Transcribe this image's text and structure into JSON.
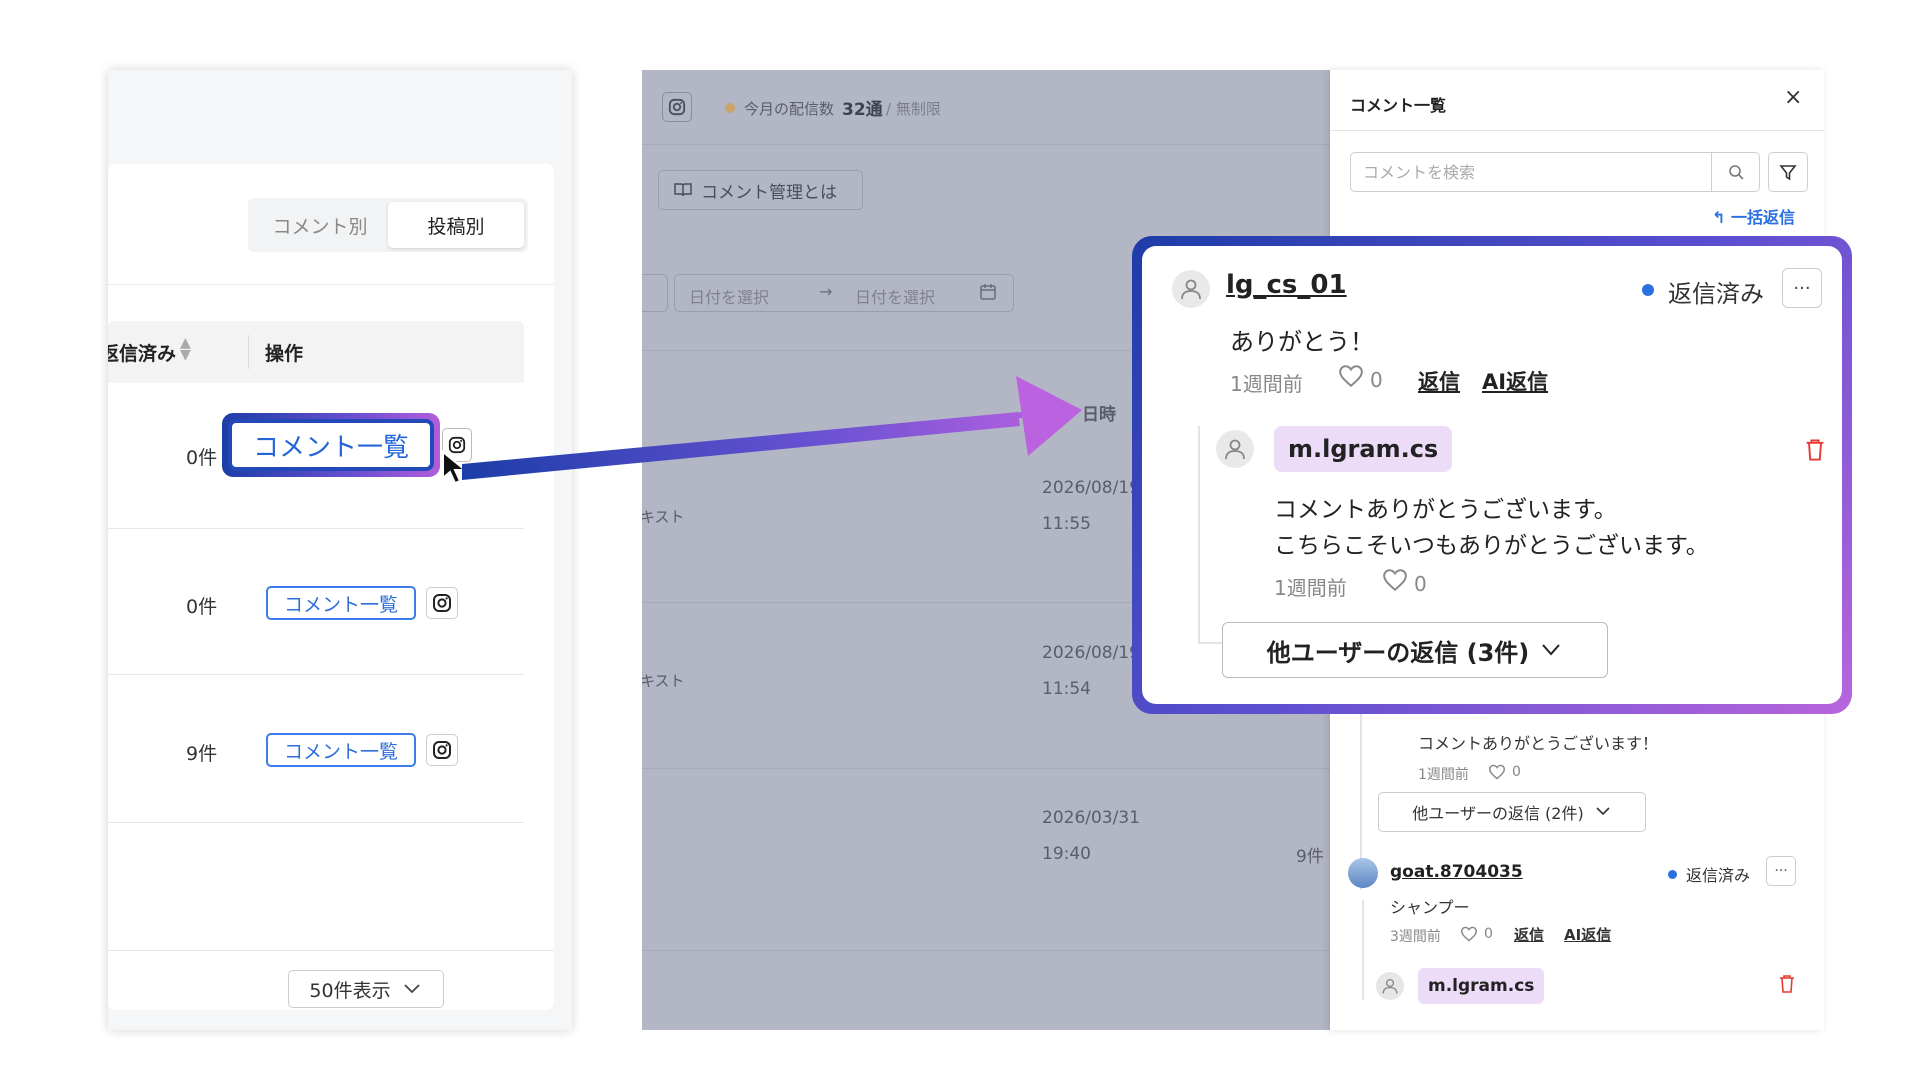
{
  "left": {
    "toggle": {
      "by_comment": "コメント別",
      "by_post": "投稿別"
    },
    "table": {
      "col_replied": "返信済み",
      "col_ops": "操作",
      "rows": [
        {
          "count": "0件",
          "button": "コメント一覧"
        },
        {
          "count": "0件",
          "button": "コメント一覧"
        },
        {
          "count": "9件",
          "button": "コメント一覧"
        }
      ]
    },
    "page_size": "50件表示"
  },
  "center": {
    "delivery_label": "今月の配信数",
    "delivery_count": "32通",
    "delivery_limit": "/ 無制限",
    "help_button": "コメント管理とは",
    "date_from_placeholder": "日付を選択",
    "date_arrow": "→",
    "date_to_placeholder": "日付を選択",
    "col_date": "日時",
    "rows": [
      {
        "text": "キスト",
        "date": "2026/08/19",
        "time": "11:55"
      },
      {
        "text": "キスト",
        "date": "2026/08/19",
        "time": "11:54"
      },
      {
        "text": "",
        "date": "2026/03/31",
        "time": "19:40"
      }
    ],
    "count_9": "9件"
  },
  "drawer": {
    "title": "コメント一覧",
    "close": "×",
    "search_placeholder": "コメントを検索",
    "bulk_reply": "一括返信",
    "partial_reply_text": "コメントありがとうございます！",
    "partial_reply_time": "1週間前",
    "partial_reply_likes": "0",
    "others_2": "他ユーザーの返信 (2件)",
    "goat": {
      "user": "goat.8704035",
      "status": "返信済み",
      "more": "···",
      "text": "シャンプー",
      "time": "3週間前",
      "likes": "0",
      "reply": "返信",
      "ai_reply": "AI返信"
    },
    "reply2_user": "m.lgram.cs"
  },
  "zoom": {
    "user": "lg_cs_01",
    "status": "返信済み",
    "more": "···",
    "text": "ありがとう！",
    "time": "1週間前",
    "likes": "0",
    "reply": "返信",
    "ai_reply": "AI返信",
    "reply_user": "m.lgram.cs",
    "reply_text_1": "コメントありがとうございます。",
    "reply_text_2": "こちらこそいつもありがとうございます。",
    "reply_time": "1週間前",
    "reply_likes": "0",
    "others": "他ユーザーの返信 (3件)"
  },
  "colors": {
    "accent_blue": "#2b6fe0",
    "callout_start": "#1d3ca8",
    "callout_end": "#b865dc",
    "user_pill": "#ecdcf7",
    "trash_red": "#e53935"
  },
  "icons": [
    "instagram-icon",
    "search-icon",
    "filter-icon",
    "close-icon",
    "heart-icon",
    "trash-icon",
    "user-avatar-icon",
    "chevron-down-icon",
    "reply-arrow-icon",
    "book-icon",
    "calendar-icon",
    "cursor-icon"
  ]
}
